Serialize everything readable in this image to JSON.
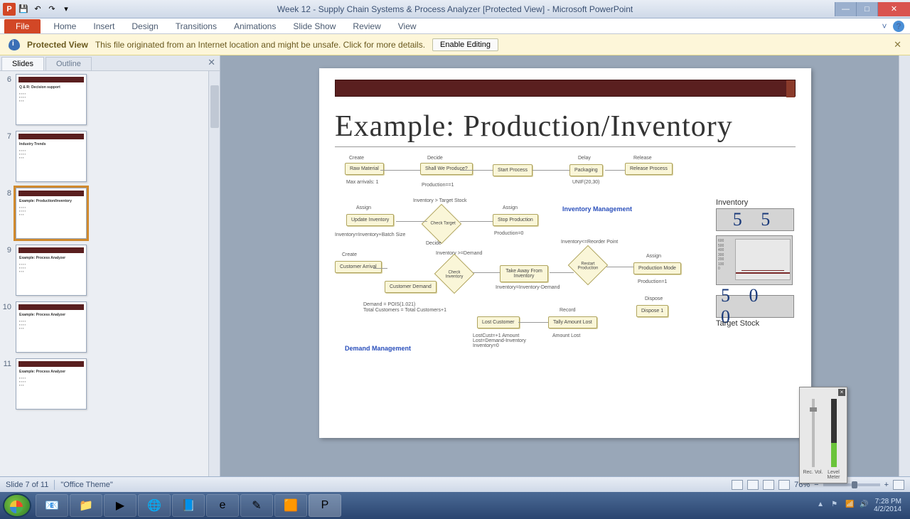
{
  "titlebar": {
    "title": "Week 12 - Supply Chain Systems & Process Analyzer [Protected View] - Microsoft PowerPoint"
  },
  "ribbon": {
    "file": "File",
    "tabs": [
      "Home",
      "Insert",
      "Design",
      "Transitions",
      "Animations",
      "Slide Show",
      "Review",
      "View"
    ]
  },
  "protected": {
    "label": "Protected View",
    "msg": "This file originated from an Internet location and might be unsafe. Click for more details.",
    "button": "Enable Editing"
  },
  "panel": {
    "tab_slides": "Slides",
    "tab_outline": "Outline",
    "thumbs": [
      {
        "num": "6",
        "title": "Q & R: Decision support"
      },
      {
        "num": "7",
        "title": "Industry Trends"
      },
      {
        "num": "8",
        "title": "Example: Production/Inventory"
      },
      {
        "num": "9",
        "title": "Example: Process Analyzer"
      },
      {
        "num": "10",
        "title": "Example: Process Analyzer"
      },
      {
        "num": "11",
        "title": "Example: Process Analyzer"
      }
    ],
    "selected_index": 2
  },
  "slide": {
    "heading": "Example: Production/Inventory",
    "labels": {
      "inventory_mgmt": "Inventory Management",
      "demand_mgmt": "Demand Management",
      "inventory": "Inventory",
      "target_stock": "Target Stock"
    },
    "inventory_value": "5 5",
    "target_value": "5 0 0",
    "boxes": {
      "raw": "Raw Material",
      "shall": "Shall We\nProduce?",
      "start": "Start Process",
      "pack": "Packaging",
      "release": "Release\nProcess",
      "update_inv": "Update Inventory",
      "check_target": "Check Target",
      "stop_prod": "Stop Production",
      "cust_arrival": "Customer Arrival",
      "cust_demand": "Customer\nDemand",
      "check_inv": "Check Inventory",
      "take_inv": "Take Away From\nInventory",
      "restart": "Restart Production",
      "prod_mode": "Production Mode",
      "lost_cust": "Lost Customer",
      "tally": "Tally Amount Lost",
      "dispose": "Dispose 1"
    },
    "small_labels": {
      "create": "Create",
      "decide": "Decide",
      "assign": "Assign",
      "record": "Record",
      "dispose": "Dispose",
      "delay": "Delay",
      "release": "Release",
      "max_arrivals": "Max arrivals: 1",
      "production": "Production==1",
      "inv_target": "Inventory > Target Stock",
      "prod0": "Production=0",
      "inv_demand": "Inventory >=Demand",
      "inv_formula": "Inventory=Inventory-Demand",
      "reorder": "Inventory<=Reorder Point",
      "prod1": "Production=1",
      "demand_dist": "Demand = POIS(1.021)",
      "total_cust": "Total Customers = Total Customers+1",
      "lost_formula": "LostCust=+1\nAmount Lost=Demand-Inventory\nInventory=0",
      "amount_lost": "Amount Lost",
      "unif": "UNIF(20,30)",
      "invinv": "Inventory=Inventory+Batch Size"
    }
  },
  "statusbar": {
    "slide_info": "Slide 7 of 11",
    "theme": "\"Office Theme\"",
    "zoom": "76%"
  },
  "mixer": {
    "rec": "Rec.\nVol.",
    "level": "Level\nMeter"
  },
  "taskbar": {
    "time": "7:28 PM",
    "date": "4/2/2014"
  }
}
